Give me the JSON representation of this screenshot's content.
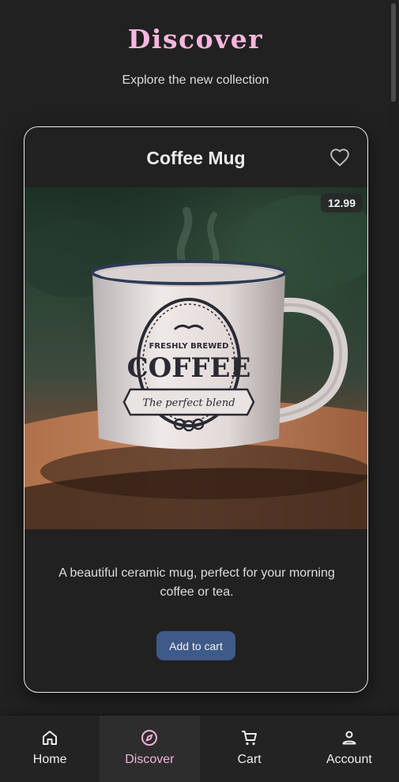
{
  "header": {
    "title": "Discover",
    "subtitle": "Explore the new collection"
  },
  "product": {
    "name": "Coffee Mug",
    "price": "12.99",
    "description": "A beautiful ceramic mug, perfect for your morning coffee or tea.",
    "add_to_cart_label": "Add to cart",
    "favorite_icon": "heart-outline-icon",
    "image": {
      "mug_text_top": "FRESHLY BREWED",
      "mug_text_main": "COFFEE",
      "mug_text_ribbon": "The perfect blend"
    }
  },
  "nav": {
    "items": [
      {
        "label": "Home",
        "icon": "home-icon",
        "active": false
      },
      {
        "label": "Discover",
        "icon": "compass-icon",
        "active": true
      },
      {
        "label": "Cart",
        "icon": "cart-icon",
        "active": false
      },
      {
        "label": "Account",
        "icon": "person-icon",
        "active": false
      }
    ]
  },
  "colors": {
    "background": "#212121",
    "accent_pink": "#f7b7de",
    "button_blue": "#3e5a89"
  }
}
